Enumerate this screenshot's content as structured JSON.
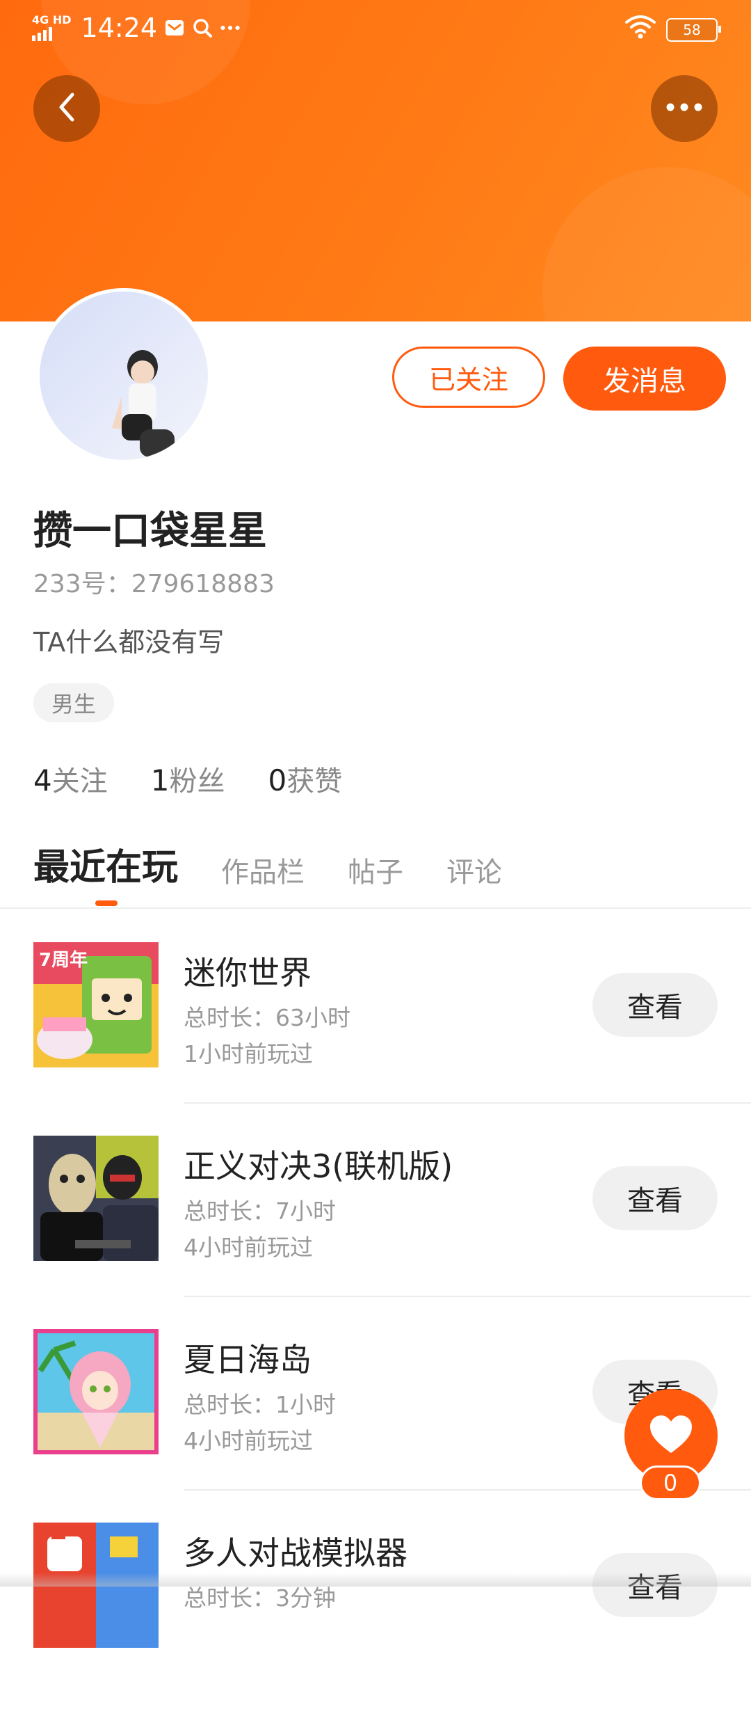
{
  "status_bar": {
    "network": "4G HD",
    "time": "14:24",
    "battery": "58",
    "icons": [
      "signal-icon",
      "mail-notification-icon",
      "search-notification-icon",
      "more-notifications-icon",
      "wifi-icon",
      "battery-icon"
    ]
  },
  "header": {
    "back_icon": "chevron-left-icon",
    "more_icon": "more-horizontal-icon",
    "accent_color": "#ff6a0e"
  },
  "profile": {
    "follow_label": "已关注",
    "message_label": "发消息",
    "username": "攒一口袋星星",
    "user_id": "233号：279618883",
    "bio": "TA什么都没有写",
    "gender": "男生"
  },
  "stats": [
    {
      "num": "4",
      "label": "关注"
    },
    {
      "num": "1",
      "label": "粉丝"
    },
    {
      "num": "0",
      "label": "获赞"
    }
  ],
  "tabs": [
    "最近在玩",
    "作品栏",
    "帖子",
    "评论"
  ],
  "active_tab": 0,
  "games": [
    {
      "name": "迷你世界",
      "duration": "总时长：63小时",
      "last_played": "1小时前玩过",
      "button": "查看"
    },
    {
      "name": "正义对决3(联机版)",
      "duration": "总时长：7小时",
      "last_played": "4小时前玩过",
      "button": "查看"
    },
    {
      "name": "夏日海岛",
      "duration": "总时长：1小时",
      "last_played": "4小时前玩过",
      "button": "查看"
    },
    {
      "name": "多人对战模拟器",
      "duration": "总时长：3分钟",
      "last_played": "",
      "button": "查看"
    }
  ],
  "like": {
    "count": "0",
    "icon": "heart-icon"
  }
}
